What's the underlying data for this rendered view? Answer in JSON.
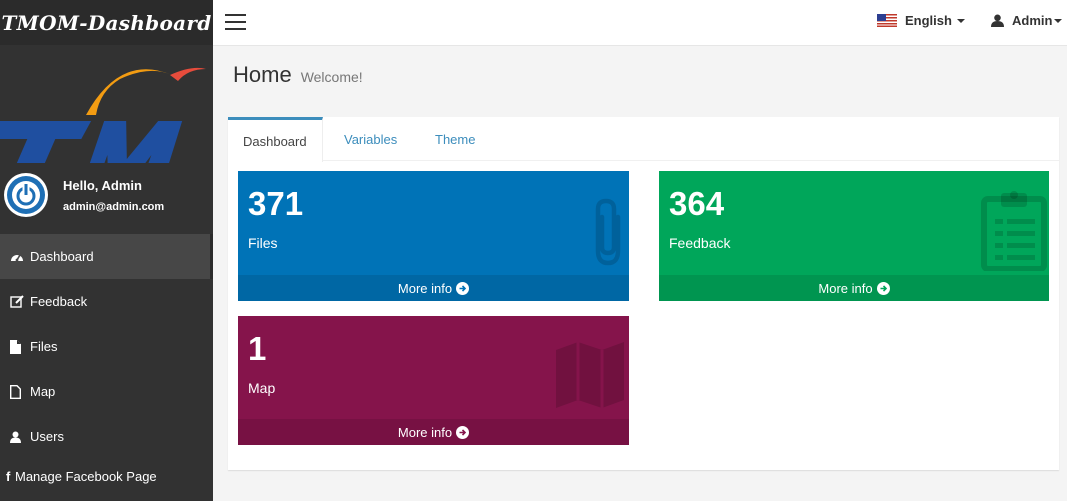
{
  "app": {
    "brand": "TMOM-Dashboard"
  },
  "sidebar": {
    "user": {
      "hello": "Hello, Admin",
      "email": "admin@admin.com"
    },
    "items": [
      {
        "label": "Dashboard",
        "icon": "dashboard-icon",
        "active": true
      },
      {
        "label": "Feedback",
        "icon": "edit-icon"
      },
      {
        "label": "Files",
        "icon": "file-icon"
      },
      {
        "label": "Map",
        "icon": "file-outline-icon"
      },
      {
        "label": "Users",
        "icon": "user-icon"
      },
      {
        "label": "Manage Facebook Page",
        "icon": "facebook-icon"
      }
    ]
  },
  "topbar": {
    "language": "English",
    "user": "Admin"
  },
  "page": {
    "title": "Home",
    "subtitle": "Welcome!"
  },
  "tabs": [
    {
      "label": "Dashboard",
      "active": true
    },
    {
      "label": "Variables"
    },
    {
      "label": "Theme"
    }
  ],
  "cards": [
    {
      "value": "371",
      "label": "Files",
      "footer": "More info",
      "color": "#0073b7",
      "icon": "paperclip-icon"
    },
    {
      "value": "364",
      "label": "Feedback",
      "footer": "More info",
      "color": "#00a65a",
      "icon": "clipboard-icon"
    },
    {
      "value": "1",
      "label": "Map",
      "footer": "More info",
      "color": "#85144b",
      "icon": "map-icon"
    }
  ],
  "colors": {
    "sidebar": "#323232",
    "accent": "#3c8dbc",
    "logo_blue": "#1f4fa0",
    "logo_orange": "#f39c12"
  }
}
